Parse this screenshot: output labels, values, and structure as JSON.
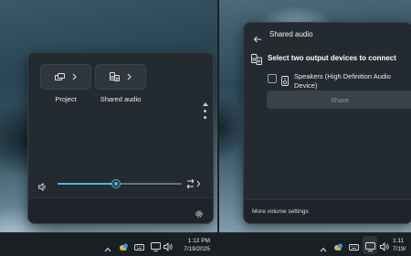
{
  "left": {
    "tiles": [
      {
        "label": "Project",
        "icon": "project-icon"
      },
      {
        "label": "Shared audio",
        "icon": "shared-audio-icon"
      }
    ],
    "volume": {
      "level": 0.47,
      "icon": "speaker-icon"
    },
    "footer": {
      "icon": "gear-icon"
    },
    "taskbar": {
      "time": "1:12 PM",
      "date": "7/19/2025"
    }
  },
  "right": {
    "header": {
      "title": "Shared audio"
    },
    "heading": "Select two output devices to connect",
    "device": {
      "label": "Speakers (High Definition Audio Device)",
      "checked": false
    },
    "share_button": "Share",
    "footer_link": "More volume settings",
    "taskbar": {
      "time": "1:11",
      "date": "7/19/"
    }
  },
  "colors": {
    "accent": "#4fb3e8",
    "flyout": "#232a30",
    "taskbar": "#1a1f23"
  }
}
